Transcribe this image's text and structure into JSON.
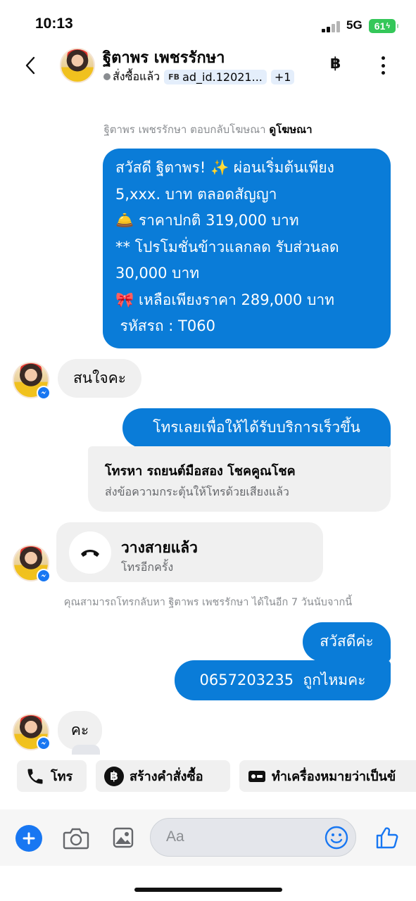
{
  "status_bar": {
    "time": "10:13",
    "network": "5G",
    "battery": "61"
  },
  "header": {
    "contact_name": "ฐิตาพร เพชรรักษา",
    "status_label": "สั่งซื้อแล้ว",
    "tag_prefix": "FB",
    "tag_label": "ad_id.12021...",
    "extra_tags": "+1",
    "baht_icon": "฿",
    "icons": [
      "back-chevron-icon",
      "baht-icon",
      "more-vertical-icon"
    ]
  },
  "messages": {
    "ad_reply_prefix": "ฐิตาพร เพชรรักษา ตอบกลับโฆษณา",
    "ad_reply_link": "ดูโฆษณา",
    "promo_lines": [
      "สวัสดี ฐิตาพร! ✨  ผ่อนเริ่มต้นเพียง",
      "5,xxx. บาท ตลอดสัญญา",
      "🛎️ ราคาปกติ 319,000 บาท",
      "** โปรโมชั่นข้าวแลกลด รับส่วนลด",
      "30,000 บาท",
      "🎀  เหลือเพียงราคา 289,000 บาท",
      " รหัสรถ : T060"
    ],
    "incoming_1": "สนใจคะ",
    "outgoing_call_prompt": "โทรเลยเพื่อให้ได้รับบริการเร็วขึ้น",
    "call_card_title": "โทรหา รถยนต์มือสอง โชคคูณโชค",
    "call_card_sub": "ส่งข้อความกระตุ้นให้โทรด้วยเสียงแล้ว",
    "missed_call_title": "วางสายแล้ว",
    "missed_call_sub": "โทรอีกครั้ง",
    "callback_notice": "คุณสามารถโทรกลับหา ฐิตาพร เพชรรักษา ได้ในอีก 7 วันนับจากนี้",
    "outgoing_greeting": "สวัสดีค่ะ",
    "outgoing_phone": "0657203235  ถูกไหมคะ",
    "incoming_2": "คะ"
  },
  "quick_actions": {
    "call": "โทร",
    "create_order": "สร้างคำสั่งซื้อ",
    "mark_as": "ทำเครื่องหมายว่าเป็นข้"
  },
  "composer": {
    "placeholder": "Aa"
  },
  "colors": {
    "outgoing_bubble": "#0a7cd8",
    "incoming_bubble": "#f0f0f0",
    "accent_blue": "#1877f2",
    "battery_green": "#34c759"
  }
}
